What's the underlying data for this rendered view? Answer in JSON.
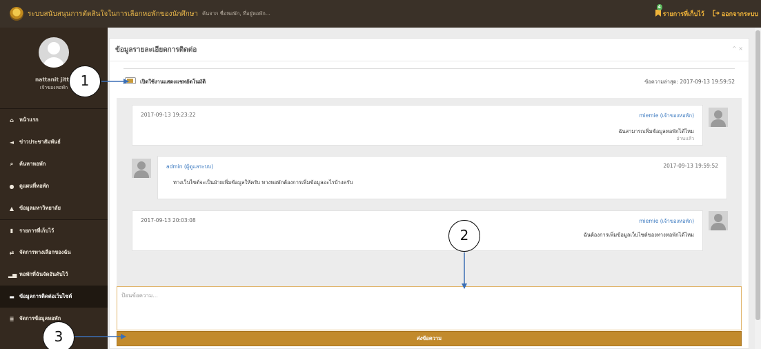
{
  "header": {
    "brand": "ระบบสนับสนุนการตัดสินใจในการเลือกหอพักของนักศึกษา",
    "search_hint": "ค้นจาก ชื่อหอพัก, ที่อยู่หอพัก...",
    "bookmarks_label": "รายการที่เก็บไว้",
    "bookmarks_count": "4",
    "logout_label": "ออกจากระบบ"
  },
  "sidebar": {
    "username": "nattanit jitta",
    "role": "เจ้าของหอพัก",
    "items": [
      {
        "label": "หน้าแรก",
        "icon": "home-icon"
      },
      {
        "label": "ข่าวประชาสัมพันธ์",
        "icon": "megaphone-icon"
      },
      {
        "label": "ค้นหาหอพัก",
        "icon": "search-icon"
      },
      {
        "label": "ดูแผนที่หอพัก",
        "icon": "map-marker-icon"
      },
      {
        "label": "ข้อมูลมหาวิทยาลัย",
        "icon": "graduation-cap-icon"
      },
      {
        "label": "รายการที่เก็บไว้",
        "icon": "bookmark-icon"
      },
      {
        "label": "จัดการทางเลือกของฉัน",
        "icon": "exchange-icon"
      },
      {
        "label": "หอพักที่ฉันจัดอันดับไว้",
        "icon": "bar-chart-icon"
      },
      {
        "label": "ข้อมูลการติดต่อเว็บไซต์",
        "icon": "comment-icon"
      },
      {
        "label": "จัดการข้อมูลหอพัก",
        "icon": "list-icon"
      }
    ]
  },
  "panel": {
    "title": "ข้อมูลรายละเอียดการติดต่อ",
    "tools": "^ ×",
    "toggle_label": "เปิดใช้งานแสดงแชทอัตโนมัติ",
    "latest": "ข้อความล่าสุด: 2017-09-13 19:59:52"
  },
  "messages": [
    {
      "date": "2017-09-13 19:23:22",
      "sender": "miemie (เจ้าของหอพัก)",
      "text": "ฉันสามารถเพิ่มข้อมูลหอพักได้ไหม",
      "status": "อ่านแล้ว"
    },
    {
      "date": "2017-09-13 19:59:52",
      "sender": "admin (ผู้ดูแลระบบ)",
      "text": "ทางเว็บไซต์จะเป็นฝ่ายเพิ่มข้อมูลให้ครับ ทางหอพักต้องการเพิ่มข้อมูลอะไรบ้างครับ"
    },
    {
      "date": "2017-09-13 20:03:08",
      "sender": "miemie (เจ้าของหอพัก)",
      "text": "ฉันต้องการเพิ่มข้อมูลเว็บไซต์ของทางหอพักได้ไหม"
    }
  ],
  "input": {
    "placeholder": "ป้อนข้อความ..."
  },
  "send_label": "ส่งข้อความ",
  "callouts": [
    "1",
    "2",
    "3"
  ],
  "colors": {
    "topbar": "#3a3128",
    "sidebar": "#34291f",
    "accent": "#c28a2c",
    "link": "#3c7ac0"
  }
}
